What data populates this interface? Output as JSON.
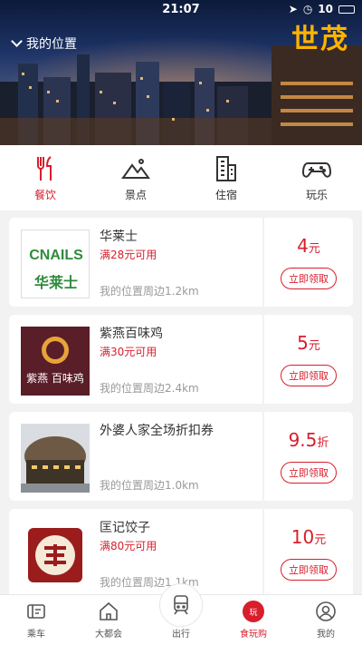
{
  "status": {
    "time": "21:07",
    "battery": "10"
  },
  "header": {
    "location_label": "我的位置",
    "sign_text": "世茂"
  },
  "categories": [
    {
      "label": "餐饮",
      "icon": "fork-knife-icon",
      "active": true
    },
    {
      "label": "景点",
      "icon": "mountain-icon",
      "active": false
    },
    {
      "label": "住宿",
      "icon": "building-icon",
      "active": false
    },
    {
      "label": "玩乐",
      "icon": "gamepad-icon",
      "active": false
    }
  ],
  "coupons": [
    {
      "name": "华莱士",
      "condition": "满28元可用",
      "distance": "我的位置周边1.2km",
      "amount": "4",
      "unit": "元",
      "claim": "立即领取",
      "logo_text": "华莱士"
    },
    {
      "name": "紫燕百味鸡",
      "condition": "满30元可用",
      "distance": "我的位置周边2.4km",
      "amount": "5",
      "unit": "元",
      "claim": "立即领取",
      "logo_text": "紫燕 百味鸡"
    },
    {
      "name": "外婆人家全场折扣券",
      "condition": "",
      "distance": "我的位置周边1.0km",
      "amount": "9.5",
      "unit": "折",
      "claim": "立即领取"
    },
    {
      "name": "匡记饺子",
      "condition": "满80元可用",
      "distance": "我的位置周边1.1km",
      "amount": "10",
      "unit": "元",
      "claim": "立即领取"
    }
  ],
  "tabs": [
    {
      "label": "乘车",
      "icon": "ticket-icon"
    },
    {
      "label": "大都会",
      "icon": "house-icon"
    },
    {
      "label": "出行",
      "icon": "train-icon"
    },
    {
      "label": "食玩购",
      "icon": "play-badge-icon",
      "badge": "玩",
      "active": true
    },
    {
      "label": "我的",
      "icon": "user-icon"
    }
  ],
  "colors": {
    "accent": "#d81e2c",
    "muted": "#999999",
    "background": "#f2f2f2"
  }
}
